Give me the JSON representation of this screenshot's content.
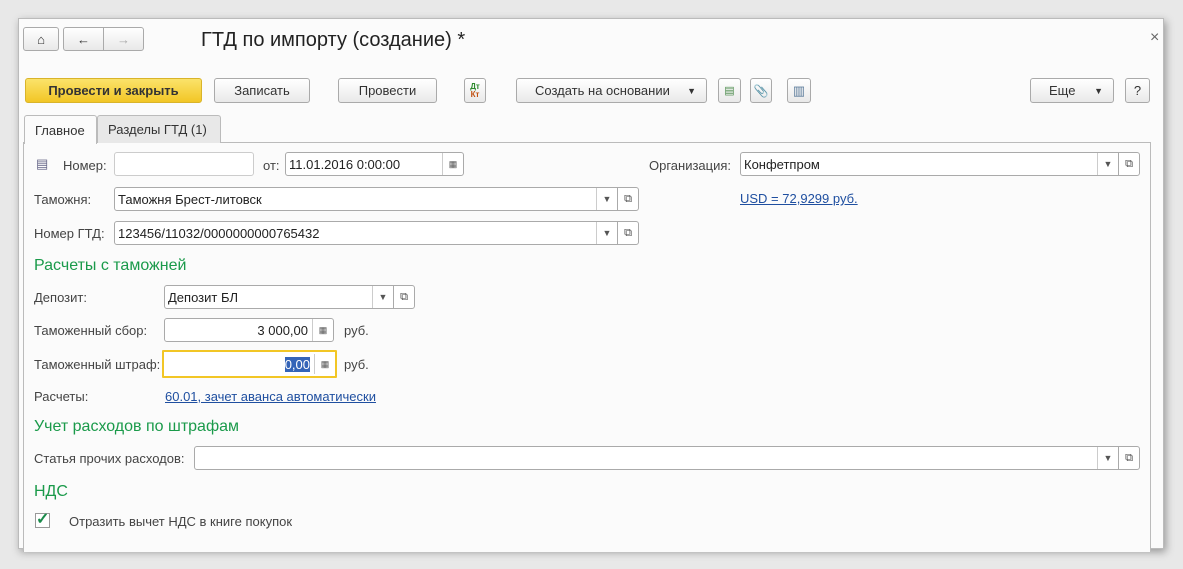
{
  "window": {
    "title": "ГТД по импорту (создание) *",
    "close": "×"
  },
  "nav": {
    "home": "home-icon",
    "back": "←",
    "forward": "→"
  },
  "toolbar": {
    "post_close": "Провести и закрыть",
    "save": "Записать",
    "post": "Провести",
    "dtkt_top": "Дт",
    "dtkt_bottom": "Кт",
    "create_based": "Создать на основании",
    "more": "Еще",
    "help": "?"
  },
  "tabs": [
    {
      "label": "Главное",
      "active": true
    },
    {
      "label": "Разделы ГТД (1)",
      "active": false
    }
  ],
  "form": {
    "number_label": "Номер:",
    "number_value": "",
    "date_label": "от:",
    "date_value": "11.01.2016  0:00:00",
    "org_label": "Организация:",
    "org_value": "Конфетпром",
    "rate_link": "USD = 72,9299 руб.",
    "customs_label": "Таможня:",
    "customs_value": "Таможня Брест-литовск",
    "gtd_label": "Номер ГТД:",
    "gtd_value": "123456/11032/0000000000765432",
    "section1": "Расчеты с таможней",
    "deposit_label": "Депозит:",
    "deposit_value": "Депозит БЛ",
    "fee_label": "Таможенный сбор:",
    "fee_value": "3 000,00",
    "fee_unit": "руб.",
    "fine_label": "Таможенный штраф:",
    "fine_value": "0,00",
    "fine_unit": "руб.",
    "settle_label": "Расчеты:",
    "settle_link": "60.01, зачет аванса автоматически",
    "section2": "Учет расходов по штрафам",
    "expense_label": "Статья прочих расходов:",
    "expense_value": "",
    "section3": "НДС",
    "vat_checkbox_label": "Отразить вычет НДС в книге покупок",
    "vat_checked": true
  },
  "colors": {
    "primary": "#f5cd33",
    "heading": "#1a9a4a",
    "link": "#1f4fa0",
    "focus": "#f2c625"
  }
}
